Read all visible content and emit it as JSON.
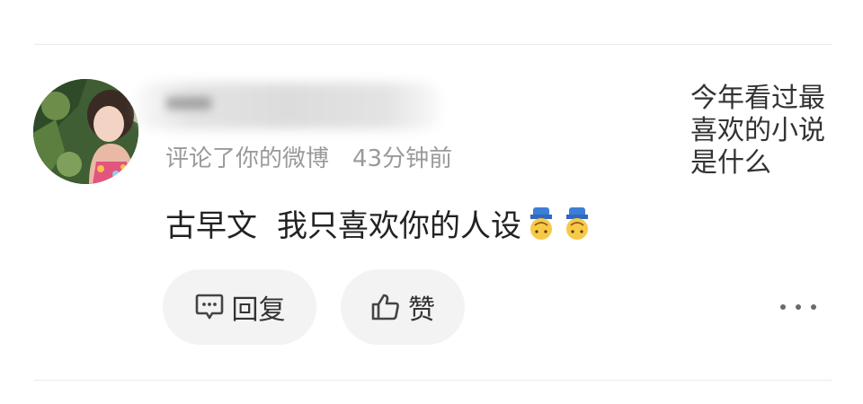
{
  "comment_item": {
    "username": "",
    "action_text": "评论了你的微博",
    "timestamp": "43分钟前",
    "comment_parts": [
      "古早文",
      "我只喜欢你的人设"
    ],
    "emojis": [
      "upside-down-face-emoji",
      "upside-down-face-emoji"
    ],
    "actions": {
      "reply_label": "回复",
      "like_label": "赞"
    },
    "original_post_preview": [
      "今年看过最",
      "喜欢的小说",
      "是什么"
    ]
  },
  "icons": {
    "reply": "comment-bubble-icon",
    "like": "thumbs-up-icon",
    "more": "more-dots-icon"
  },
  "colors": {
    "meta_text": "#9a9a9a",
    "primary_text": "#222222",
    "button_bg": "#f3f3f3",
    "divider": "#ebebeb"
  }
}
